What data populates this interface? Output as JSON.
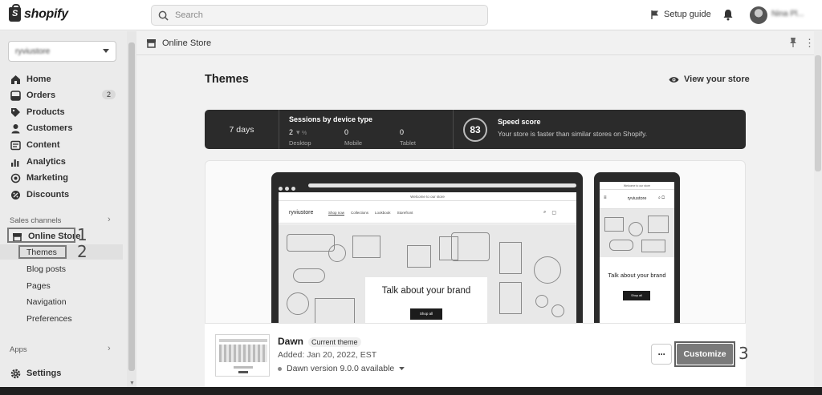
{
  "topbar": {
    "logo_text": "shopify",
    "search_placeholder": "Search",
    "setup_guide": "Setup guide",
    "user_name": "Nina Pl..."
  },
  "sidebar": {
    "store_name": "ryviustore",
    "items": [
      {
        "label": "Home",
        "icon": "home-icon"
      },
      {
        "label": "Orders",
        "icon": "orders-icon",
        "badge": "2"
      },
      {
        "label": "Products",
        "icon": "tag-icon"
      },
      {
        "label": "Customers",
        "icon": "person-icon"
      },
      {
        "label": "Content",
        "icon": "content-icon"
      },
      {
        "label": "Analytics",
        "icon": "bar-chart-icon"
      },
      {
        "label": "Marketing",
        "icon": "target-icon"
      },
      {
        "label": "Discounts",
        "icon": "discount-icon"
      }
    ],
    "sales_channels_label": "Sales channels",
    "online_store_label": "Online Store",
    "sub_items": [
      "Themes",
      "Blog posts",
      "Pages",
      "Navigation",
      "Preferences"
    ],
    "apps_label": "Apps",
    "settings_label": "Settings"
  },
  "annotations": {
    "one": "1",
    "two": "2",
    "three": "3"
  },
  "breadcrumb": {
    "label": "Online Store"
  },
  "page": {
    "title": "Themes",
    "view_store": "View your store"
  },
  "stats": {
    "period": "7 days",
    "sessions_title": "Sessions by device type",
    "devices": [
      {
        "value": "2",
        "label": "Desktop"
      },
      {
        "value": "0",
        "label": "Mobile"
      },
      {
        "value": "0",
        "label": "Tablet"
      }
    ],
    "speed_score": "83",
    "speed_title": "Speed score",
    "speed_desc": "Your store is faster than similar stores on Shopify."
  },
  "preview": {
    "announcement": "Welcome to our store",
    "store_brand": "ryviustore",
    "menu": [
      "Shop now",
      "Collections",
      "Lookbook",
      "Storefront"
    ],
    "hero_title": "Talk about your brand",
    "hero_button": "Shop all",
    "mobile_hero_title": "Talk about your brand",
    "mobile_button": "Shop all"
  },
  "theme": {
    "name": "Dawn",
    "status_tag": "Current theme",
    "added": "Added: Jan 20, 2022, EST",
    "version": "Dawn version 9.0.0 available",
    "customize": "Customize"
  },
  "colors": {
    "accent_dark": "#2b2b2b",
    "customize_bg": "#7a7a7a"
  }
}
